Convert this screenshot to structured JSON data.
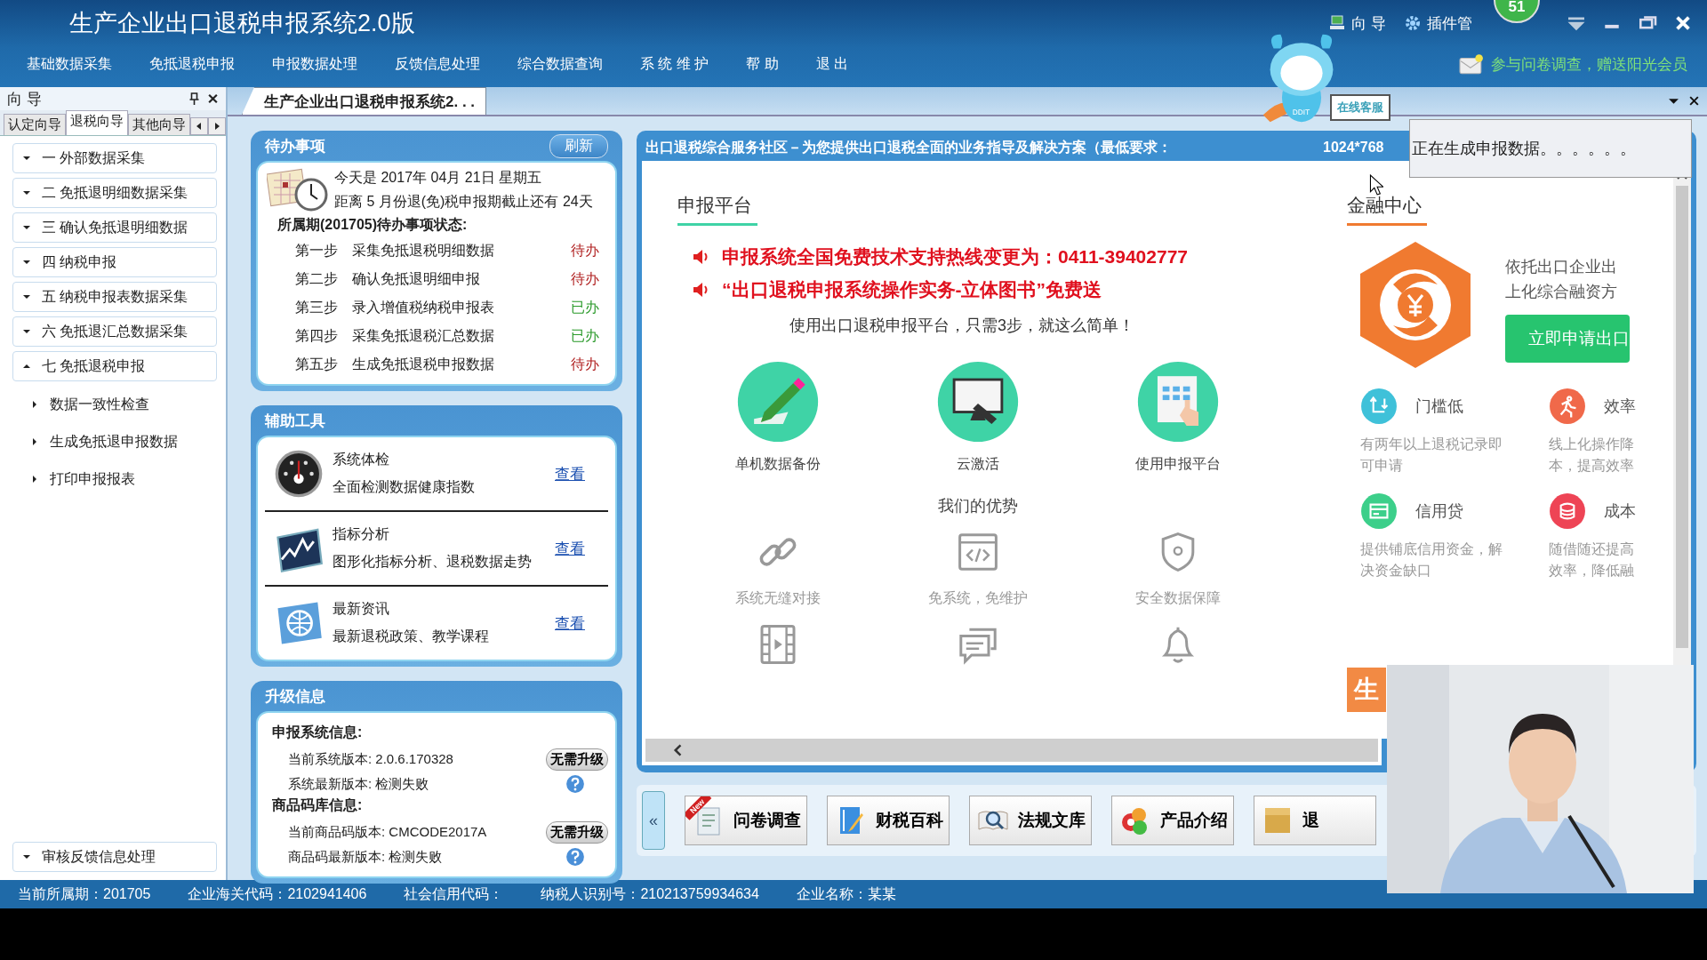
{
  "window": {
    "title": "生产企业出口退税申报系统2.0版",
    "top_links": [
      {
        "kind": "wizard",
        "label": "向 导"
      },
      {
        "kind": "plugin",
        "label": "插件管"
      }
    ],
    "notification_count": "51"
  },
  "menu": [
    "基础数据采集",
    "免抵退税申报",
    "申报数据处理",
    "反馈信息处理",
    "综合数据查询",
    "系 统 维 护",
    "帮 助",
    "退 出"
  ],
  "survey_link": "参与问卷调查，赠送阳光会员",
  "assistant": {
    "badge": "DDIT",
    "label": "在线客服"
  },
  "nav_panel": {
    "title": "向 导",
    "tabs": [
      {
        "label": "认定向导",
        "selected": false
      },
      {
        "label": "退税向导",
        "selected": true
      },
      {
        "label": "其他向导",
        "selected": false
      }
    ],
    "items": [
      {
        "label": "一  外部数据采集",
        "expanded": false
      },
      {
        "label": "二  免抵退明细数据采集",
        "expanded": false
      },
      {
        "label": "三  确认免抵退明细数据",
        "expanded": false
      },
      {
        "label": "四  纳税申报",
        "expanded": false
      },
      {
        "label": "五  纳税申报表数据采集",
        "expanded": false
      },
      {
        "label": "六  免抵退汇总数据采集",
        "expanded": false
      },
      {
        "label": "七  免抵退税申报",
        "expanded": true,
        "children": [
          {
            "label": "数据一致性检查"
          },
          {
            "label": "生成免抵退申报数据"
          },
          {
            "label": "打印申报报表"
          }
        ]
      }
    ],
    "bottom_item": {
      "label": "审核反馈信息处理",
      "expanded": false
    }
  },
  "document_tab": "生产企业出口退税申报系统2. . .",
  "todo": {
    "title": "待办事项",
    "refresh": "刷新",
    "date_line": "今天是 2017年 04月 21日 星期五",
    "deadline_line": "距离 5 月份退(免)税申报期截止还有 24天",
    "period_heading": "所属期(201705)待办事项状态:",
    "steps": [
      {
        "step": "第一步",
        "task": "采集免抵退税明细数据",
        "status": "待办",
        "done": false
      },
      {
        "step": "第二步",
        "task": "确认免抵退明细申报",
        "status": "待办",
        "done": false
      },
      {
        "step": "第三步",
        "task": "录入增值税纳税申报表",
        "status": "已办",
        "done": true
      },
      {
        "step": "第四步",
        "task": "采集免抵退税汇总数据",
        "status": "已办",
        "done": true
      },
      {
        "step": "第五步",
        "task": "生成免抵退税申报数据",
        "status": "待办",
        "done": false
      }
    ]
  },
  "tools": {
    "title": "辅助工具",
    "items": [
      {
        "kind": "gauge",
        "name": "系统体检",
        "desc": "全面检测数据健康指数",
        "link": "查看"
      },
      {
        "kind": "chart",
        "name": "指标分析",
        "desc": "图形化指标分析、退税数据走势",
        "link": "查看"
      },
      {
        "kind": "globe",
        "name": "最新资讯",
        "desc": "最新退税政策、教学课程",
        "link": "查看"
      }
    ]
  },
  "upgrade": {
    "title": "升级信息",
    "groups": [
      {
        "heading": "申报系统信息:",
        "current": "当前系统版本: 2.0.6.170328",
        "button": "无需升级",
        "latest": "系统最新版本: 检测失败"
      },
      {
        "heading": "商品码库信息:",
        "current": "当前商品码版本: CMCODE2017A",
        "button": "无需升级",
        "latest": "商品码最新版本: 检测失败"
      }
    ]
  },
  "web": {
    "banner": "出口退税综合服务社区－为您提供出口退税全面的业务指导及解决方案（最低要求：",
    "banner_tail": "1024*768",
    "platform": {
      "title": "申报平台",
      "notices": [
        "申报系统全国免费技术支持热线变更为：0411-39402777",
        "“出口退税申报系统操作实务-立体图书”免费送"
      ],
      "intro": "使用出口退税申报平台，只需3步，就这么简单！",
      "steps": [
        {
          "kind": "pencil",
          "label": "单机数据备份"
        },
        {
          "kind": "monitor",
          "label": "云激活"
        },
        {
          "kind": "tablet",
          "label": "使用申报平台"
        }
      ],
      "advantages_title": "我们的优势",
      "advantages": [
        {
          "kind": "link",
          "label": "系统无缝对接"
        },
        {
          "kind": "code",
          "label": "免系统，免维护"
        },
        {
          "kind": "shield",
          "label": "安全数据保障"
        },
        {
          "kind": "film"
        },
        {
          "kind": "chat"
        },
        {
          "kind": "bell"
        }
      ]
    },
    "finance": {
      "title": "金融中心",
      "blurb": [
        "依托出口企业出",
        "上化综合融资方"
      ],
      "apply": "立即申请出口",
      "features": [
        {
          "kind": "arrows",
          "title": "门槛低",
          "color": "#3fc1d9",
          "desc": [
            "有两年以上退税记录即",
            "可申请"
          ]
        },
        {
          "kind": "runner",
          "title": "效率",
          "color": "#f0694a",
          "desc": [
            "线上化操作降",
            "本，提高效率"
          ]
        },
        {
          "kind": "card",
          "title": "信用贷",
          "color": "#3ccf8a",
          "desc": [
            "提供铺底信用资金，解",
            "决资金缺口"
          ]
        },
        {
          "kind": "coins",
          "title": "成本",
          "color": "#ee4455",
          "desc": [
            "随借随还提高",
            "效率，降低融"
          ]
        }
      ],
      "side_tab": "生"
    }
  },
  "status_popup": "正在生成申报数据。。。。。。",
  "quick_bar": {
    "collapse": "«",
    "buttons": [
      {
        "kind": "survey",
        "label": "问卷调查",
        "ribbon": "New"
      },
      {
        "kind": "book",
        "label": "财税百科"
      },
      {
        "kind": "search",
        "label": "法规文库"
      },
      {
        "kind": "product",
        "label": "产品介绍"
      },
      {
        "kind": "box",
        "label": "退"
      }
    ]
  },
  "status_bar": [
    "当前所属期：201705",
    "企业海关代码：2102941406",
    "社会信用代码：",
    "纳税人识别号：210213759934634",
    "企业名称：某某"
  ],
  "video": {
    "kind": "picture"
  }
}
